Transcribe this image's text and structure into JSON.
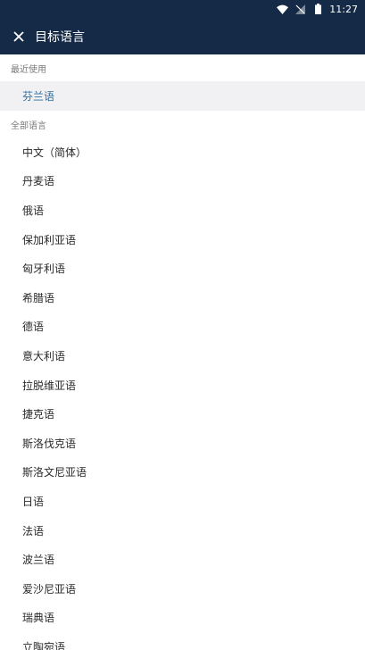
{
  "status_bar": {
    "time": "11:27",
    "icons": [
      "wifi-icon",
      "signal-icon",
      "battery-icon"
    ]
  },
  "app_bar": {
    "close_icon": "close-icon",
    "title": "目标语言"
  },
  "sections": {
    "recent_label": "最近使用",
    "all_label": "全部语言"
  },
  "recent_items": [
    {
      "label": "芬兰语"
    }
  ],
  "languages": [
    {
      "label": "中文（简体）"
    },
    {
      "label": "丹麦语"
    },
    {
      "label": "俄语"
    },
    {
      "label": "保加利亚语"
    },
    {
      "label": "匈牙利语"
    },
    {
      "label": "希腊语"
    },
    {
      "label": "德语"
    },
    {
      "label": "意大利语"
    },
    {
      "label": "拉脱维亚语"
    },
    {
      "label": "捷克语"
    },
    {
      "label": "斯洛伐克语"
    },
    {
      "label": "斯洛文尼亚语"
    },
    {
      "label": "日语"
    },
    {
      "label": "法语"
    },
    {
      "label": "波兰语"
    },
    {
      "label": "爱沙尼亚语"
    },
    {
      "label": "瑞典语"
    },
    {
      "label": "立陶宛语"
    }
  ],
  "colors": {
    "header_bg": "#142a47",
    "accent": "#2e6e9e",
    "recent_bg": "#f1f1f4"
  }
}
